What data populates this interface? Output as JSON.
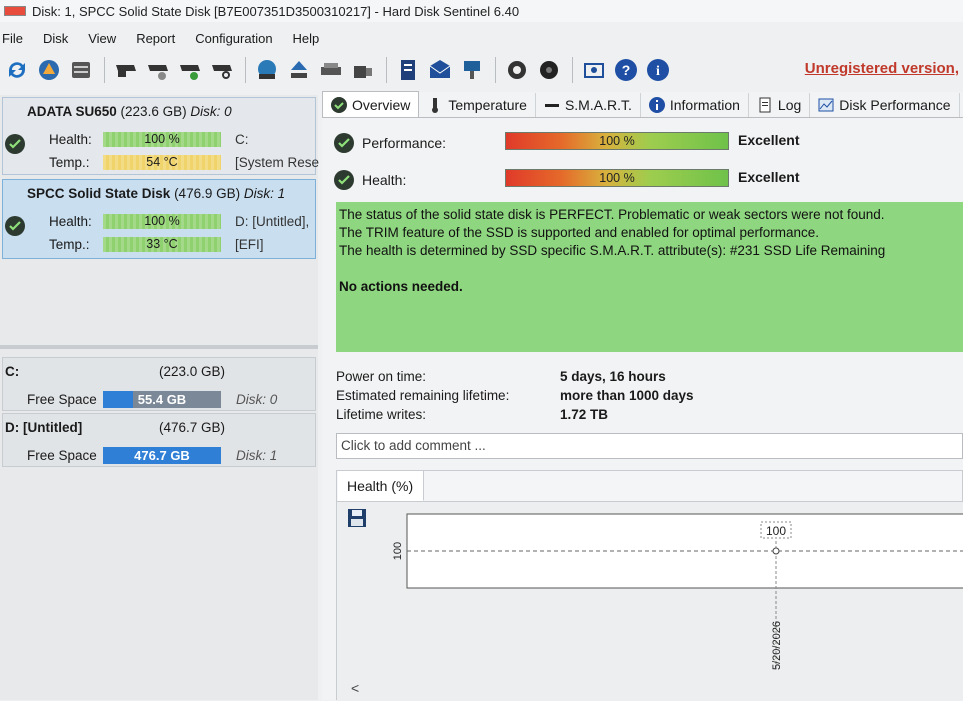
{
  "window": {
    "title": "Disk: 1, SPCC Solid State Disk [B7E007351D3500310217]  -  Hard Disk Sentinel 6.40"
  },
  "menu": [
    "File",
    "Disk",
    "View",
    "Report",
    "Configuration",
    "Help"
  ],
  "toolbar": {
    "unregistered": "Unregistered version,"
  },
  "disks": [
    {
      "name": "ADATA SU650",
      "size": "(223.6 GB)",
      "disk": "Disk: 0",
      "health_label": "Health:",
      "health": "100 %",
      "health_pct": 100,
      "temp_label": "Temp.:",
      "temp": "54 °C",
      "vol1": "C:",
      "vol2": "[System Rese",
      "selected": false
    },
    {
      "name": "SPCC Solid State Disk",
      "size": "(476.9 GB)",
      "disk": "Disk: 1",
      "health_label": "Health:",
      "health": "100 %",
      "health_pct": 100,
      "temp_label": "Temp.:",
      "temp": "33 °C",
      "vol1": "D: [Untitled],",
      "vol2": "[EFI]",
      "selected": true
    }
  ],
  "volumes": [
    {
      "name": "C:",
      "size": "(223.0 GB)",
      "free_label": "Free Space",
      "free": "55.4 GB",
      "free_fraction": 0.25,
      "disk": "Disk: 0"
    },
    {
      "name": "D: [Untitled]",
      "size": "(476.7 GB)",
      "free_label": "Free Space",
      "free": "476.7 GB",
      "free_fraction": 1.0,
      "disk": "Disk: 1"
    }
  ],
  "tabs": [
    {
      "label": "Overview",
      "icon": "check-circle-icon",
      "active": true
    },
    {
      "label": "Temperature",
      "icon": "thermometer-icon",
      "active": false
    },
    {
      "label": "S.M.A.R.T.",
      "icon": "dash-icon",
      "active": false
    },
    {
      "label": "Information",
      "icon": "info-icon",
      "active": false
    },
    {
      "label": "Log",
      "icon": "document-icon",
      "active": false
    },
    {
      "label": "Disk Performance",
      "icon": "chart-icon",
      "active": false
    }
  ],
  "overview": {
    "performance": {
      "label": "Performance:",
      "value": "100 %",
      "pct": 100,
      "rating": "Excellent"
    },
    "health": {
      "label": "Health:",
      "value": "100 %",
      "pct": 100,
      "rating": "Excellent"
    },
    "status_lines": [
      "The status of the solid state disk is PERFECT. Problematic or weak sectors were not found.",
      "The TRIM feature of the SSD is supported and enabled for optimal performance.",
      "The health is determined by SSD specific S.M.A.R.T. attribute(s):  #231 SSD Life Remaining"
    ],
    "action": "No actions needed.",
    "power_on_label": "Power on time:",
    "power_on": "5 days, 16 hours",
    "lifetime_label": "Estimated remaining lifetime:",
    "lifetime": "more than 1000 days",
    "writes_label": "Lifetime writes:",
    "writes": "1.72 TB",
    "comment_placeholder": "Click to add comment ..."
  },
  "chart_data": {
    "type": "line",
    "tab_label": "Health (%)",
    "x": [
      "5/20/2026"
    ],
    "series": [
      {
        "values": [
          100
        ]
      }
    ],
    "ytick": "100",
    "data_label": "100"
  },
  "colors": {
    "accent_green": "#8fd680",
    "health_green": "#8fd16f",
    "temp_yellow": "#f0d46b",
    "unregistered_red": "#c0392b",
    "free_blue": "#2f7fd6"
  }
}
